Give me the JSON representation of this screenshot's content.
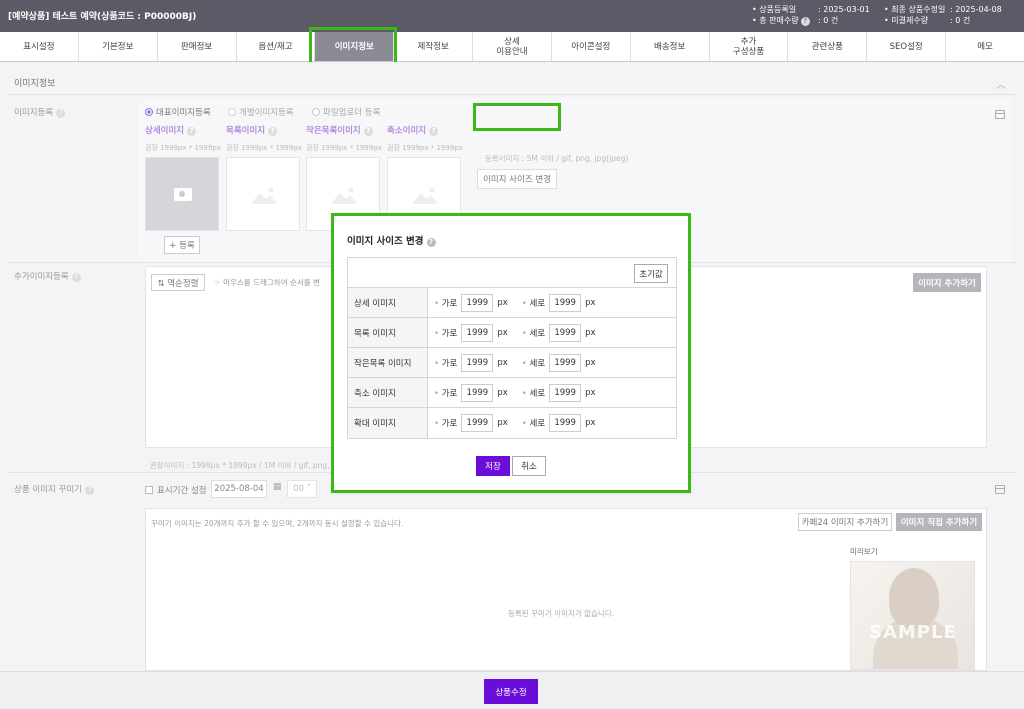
{
  "header": {
    "title": "[예약상품] 테스트 예약(상품코드 : P00000BJ)",
    "meta_left": [
      {
        "label": "상품등록일",
        "value": ": 2025-03-01"
      },
      {
        "label": "총 판매수량",
        "value": ": 0 건"
      }
    ],
    "meta_right": [
      {
        "label": "최종 상품수정일",
        "value": ": 2025-04-08"
      },
      {
        "label": "미결제수량",
        "value": ": 0 건"
      }
    ]
  },
  "tabs": [
    "표시설정",
    "기본정보",
    "판매정보",
    "옵션/재고",
    "이미지정보",
    "제작정보",
    "상세\n이용안내",
    "아이콘설정",
    "배송정보",
    "추가\n구성상품",
    "관련상품",
    "SEO설정",
    "메모"
  ],
  "active_tab": "이미지정보",
  "section": {
    "title": "이미지정보",
    "image_register_label": "이미지등록",
    "radios": [
      "대표이미지등록",
      "개별이미지등록",
      "파일업로더 등록"
    ],
    "image_types": [
      "상세이미지",
      "목록이미지",
      "작은목록이미지",
      "축소이미지"
    ],
    "image_hint": "권장 1999px * 1999px",
    "register_button": "+ 등록",
    "upload_note": "· 등록이미지 : 5M 이하 / gif, png, jpg(jpeg)",
    "resize_button": "이미지 사이즈 변경",
    "additional_label": "추가이미지등록",
    "sort_button": "⇅ 역순정렬",
    "drag_note": "마우스를 드래그하여 순서를 변",
    "add_image_button": "이미지 추가하기",
    "additional_note": "· 권장이미지 : 1999px * 1999px / 1M 이하 / gif, png, jpg",
    "decorate_label": "상품 이미지 꾸미기",
    "display_period": "표시기간 설정",
    "date_value": "2025-08-04",
    "hour_value": "00",
    "decorate_note": "꾸미기 이미지는 20개까지 추가 할 수 있으며, 2개까지 동시 설정할 수 있습니다.",
    "cafe24_button": "카페24 이미지 추가하기",
    "direct_button": "이미지 직접 추가하기",
    "empty_note": "등록된 꾸미기 이미지가 없습니다.",
    "preview_label": "미리보기",
    "sample_text": "SAMPLE"
  },
  "modal": {
    "title": "이미지 사이즈 변경",
    "reset": "초기값",
    "rows": [
      {
        "label": "상세 이미지",
        "width": "1999",
        "height": "1999"
      },
      {
        "label": "목록 이미지",
        "width": "1999",
        "height": "1999"
      },
      {
        "label": "작은목록 이미지",
        "width": "1999",
        "height": "1999"
      },
      {
        "label": "축소 이미지",
        "width": "1999",
        "height": "1999"
      },
      {
        "label": "확대 이미지",
        "width": "1999",
        "height": "1999"
      }
    ],
    "width_label": "가로",
    "height_label": "세로",
    "unit": "px",
    "save": "저장",
    "cancel": "취소"
  },
  "footer": {
    "submit": "상품수정"
  },
  "colors": {
    "accent": "#6a0dd8",
    "highlight": "#3cb818",
    "header": "#5b5a66"
  }
}
